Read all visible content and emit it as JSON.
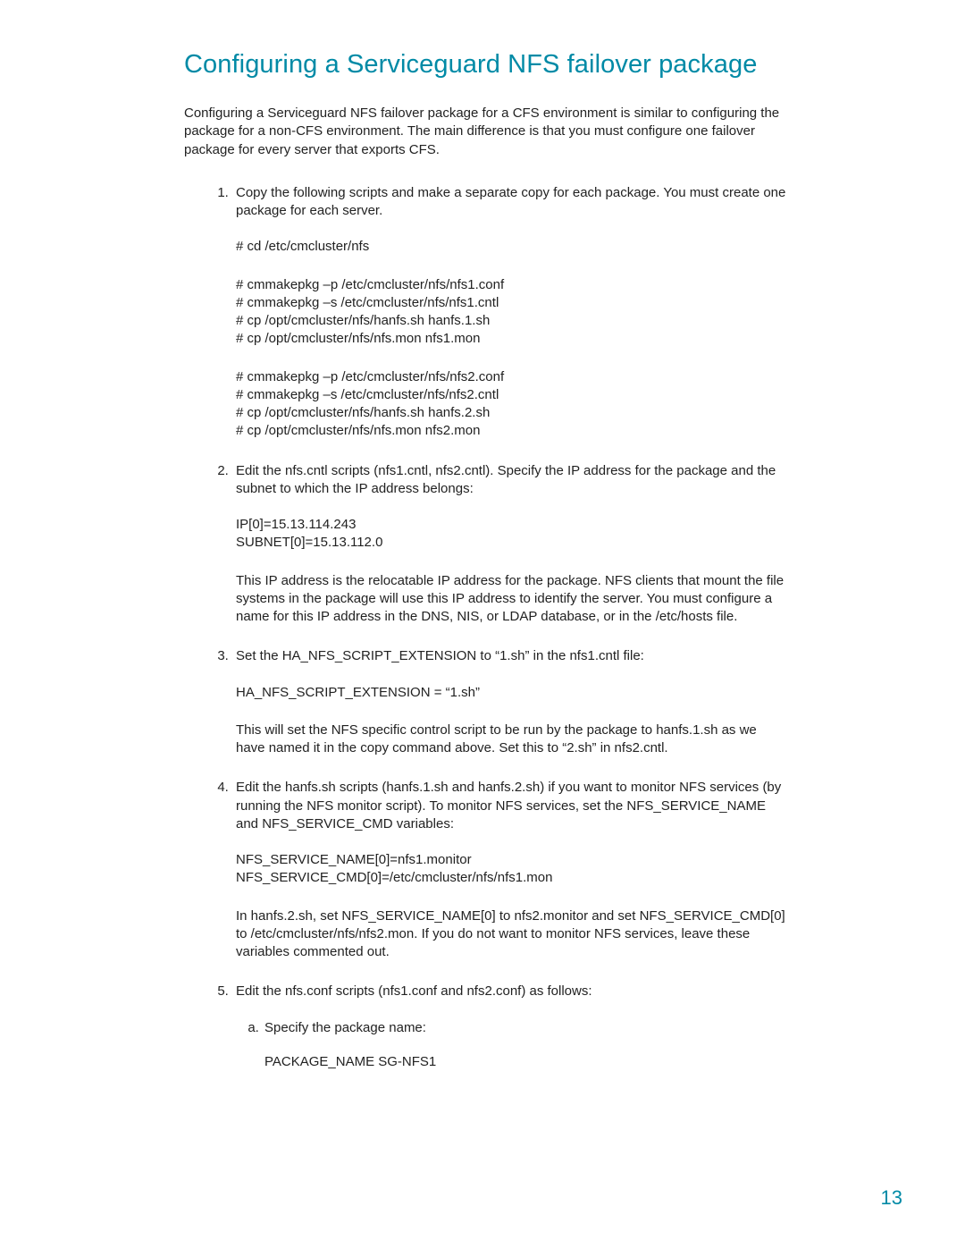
{
  "heading": "Configuring a Serviceguard NFS failover package",
  "intro": "Configuring a Serviceguard NFS failover package for a CFS environment is similar to configuring the package for a non-CFS environment. The main difference is that you must configure one failover package for every server that exports CFS.",
  "steps": {
    "s1": {
      "lead": "Copy the following scripts and make a separate copy for each package. You must create one package for each server.",
      "code1": "# cd /etc/cmcluster/nfs",
      "code2": "# cmmakepkg –p /etc/cmcluster/nfs/nfs1.conf\n# cmmakepkg –s /etc/cmcluster/nfs/nfs1.cntl\n# cp /opt/cmcluster/nfs/hanfs.sh hanfs.1.sh\n# cp /opt/cmcluster/nfs/nfs.mon nfs1.mon",
      "code3": "# cmmakepkg –p /etc/cmcluster/nfs/nfs2.conf\n# cmmakepkg –s /etc/cmcluster/nfs/nfs2.cntl\n# cp /opt/cmcluster/nfs/hanfs.sh hanfs.2.sh\n# cp /opt/cmcluster/nfs/nfs.mon nfs2.mon"
    },
    "s2": {
      "lead": "Edit the nfs.cntl scripts (nfs1.cntl, nfs2.cntl). Specify the IP address for the package and the subnet to which the IP address belongs:",
      "code": "IP[0]=15.13.114.243\nSUBNET[0]=15.13.112.0",
      "trail": "This IP address is the relocatable IP address for the package. NFS clients that mount the file systems in the package will use this IP address to identify the server. You must configure a name for this IP address in the DNS, NIS, or LDAP database, or in the /etc/hosts file."
    },
    "s3": {
      "lead": "Set the HA_NFS_SCRIPT_EXTENSION to “1.sh” in the nfs1.cntl file:",
      "code": "HA_NFS_SCRIPT_EXTENSION = “1.sh”",
      "trail": "This will set the NFS specific control script to be run by the package to hanfs.1.sh as we have named it in the copy command above. Set this to “2.sh” in nfs2.cntl."
    },
    "s4": {
      "lead": "Edit the hanfs.sh scripts (hanfs.1.sh and hanfs.2.sh) if you want to monitor NFS services (by running the NFS monitor script). To monitor NFS services, set the NFS_SERVICE_NAME and NFS_SERVICE_CMD variables:",
      "code": "NFS_SERVICE_NAME[0]=nfs1.monitor\nNFS_SERVICE_CMD[0]=/etc/cmcluster/nfs/nfs1.mon",
      "trail": "In hanfs.2.sh, set NFS_SERVICE_NAME[0] to nfs2.monitor and set NFS_SERVICE_CMD[0] to /etc/cmcluster/nfs/nfs2.mon. If you do not want to monitor NFS services, leave these variables commented out."
    },
    "s5": {
      "lead": "Edit the nfs.conf scripts (nfs1.conf and nfs2.conf) as follows:",
      "a": {
        "lead": "Specify the package name:",
        "code": "PACKAGE_NAME SG-NFS1"
      }
    }
  },
  "page_number": "13"
}
